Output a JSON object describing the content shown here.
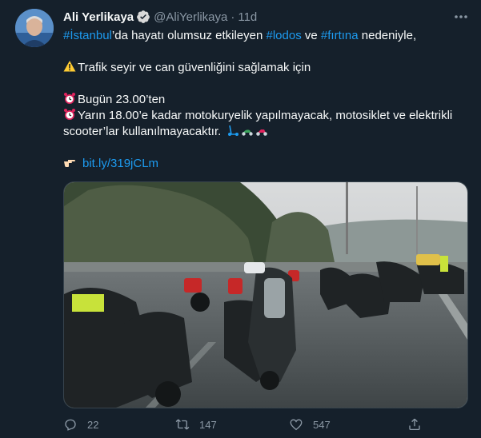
{
  "author": {
    "name": "Ali Yerlikaya",
    "handle": "@AliYerlikaya",
    "separator": "·",
    "time": "11d"
  },
  "tweet": {
    "line1": {
      "tag1": "#İstanbul",
      "text1": "’da hayatı olumsuz etkileyen ",
      "tag2": "#lodos",
      "text2": " ve ",
      "tag3": "#fırtına",
      "text3": " nedeniyle,"
    },
    "line2": "Trafik seyir ve can güvenliğini sağlamak için",
    "line3": "Bugün 23.00’ten",
    "line4": "Yarın 18.00’e kadar motokuryelik yapılmayacak, motosiklet ve elektrikli",
    "line5": "scooter’lar kullanılmayacaktır.",
    "link": "bit.ly/319jCLm"
  },
  "counts": {
    "replies": "22",
    "retweets": "147",
    "likes": "547"
  },
  "icons": {
    "more": "more-icon",
    "reply": "reply-icon",
    "retweet": "retweet-icon",
    "like": "like-icon",
    "share": "share-icon",
    "verified": "verified-badge-icon"
  },
  "colors": {
    "background": "#15202b",
    "link": "#1d9bf0",
    "muted": "#8b98a5",
    "text": "#f7f9f9"
  }
}
